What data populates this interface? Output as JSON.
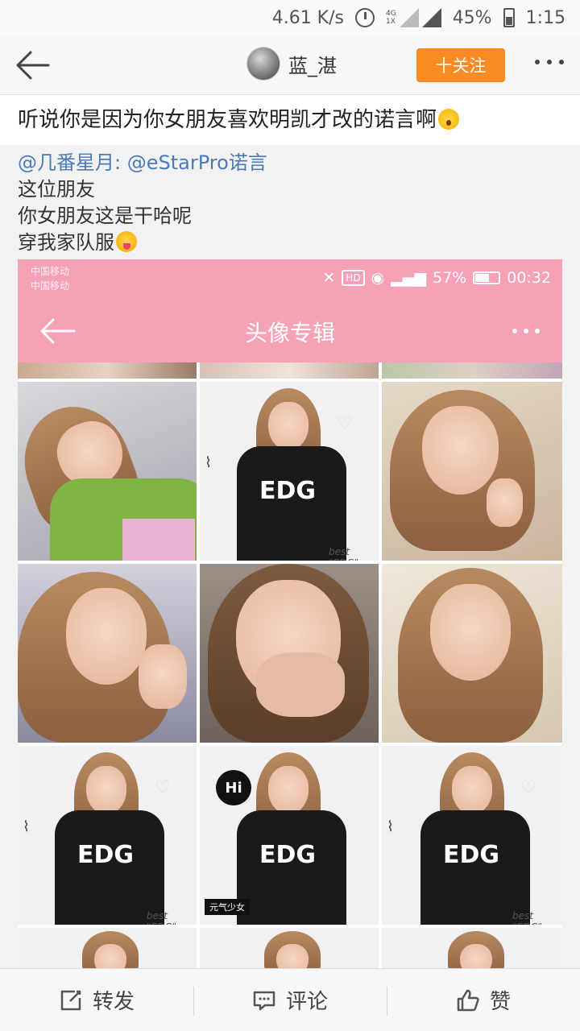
{
  "status_bar": {
    "net_speed": "4.61 K/s",
    "net_type_top": "4G",
    "net_type_bottom": "1X",
    "battery": "45%",
    "time": "1:15"
  },
  "header": {
    "username": "蓝_湛",
    "follow_label": "十关注"
  },
  "post": {
    "text": "听说你是因为你女朋友喜欢明凯才改的诺言啊"
  },
  "repost": {
    "mention_1": "@几番星月",
    "separator": ": ",
    "mention_2": "@eStarPro诺言",
    "lines": [
      "这位朋友",
      "你女朋友这是干哈呢",
      "穿我家队服"
    ]
  },
  "screenshot": {
    "carrier_1": "中国移动",
    "carrier_2": "中国移动",
    "hd": "HD",
    "battery": "57%",
    "time": "00:32",
    "title": "头像专辑",
    "jersey_logo": "EDG",
    "caption": "best \"EDG\"",
    "hi_badge": "Hi",
    "overlay_label": "元气少女"
  },
  "action_bar": {
    "repost_label": "转发",
    "comment_label": "评论",
    "like_label": "赞"
  },
  "colors": {
    "accent": "#f98a24",
    "mention": "#4a7ab8",
    "pink": "#f7a1b6"
  }
}
